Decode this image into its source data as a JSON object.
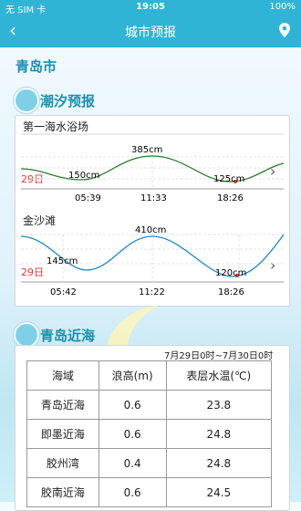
{
  "status": {
    "carrier": "无 SIM 卡",
    "time": "19:05",
    "battery": "100%"
  },
  "nav": {
    "title": "城市预报"
  },
  "city": "青岛市",
  "tide": {
    "section_title": "潮汐预报",
    "locations": [
      {
        "name": "第一海水浴场",
        "day": "29日",
        "high": "385cm",
        "low1": "150cm",
        "low2": "125cm",
        "times": [
          "05:39",
          "11:33",
          "18:26"
        ]
      },
      {
        "name": "金沙滩",
        "day": "29日",
        "high": "410cm",
        "low1": "145cm",
        "low2": "120cm",
        "times": [
          "05:42",
          "11:22",
          "18:26"
        ]
      }
    ]
  },
  "coastal": {
    "section_title": "青岛近海",
    "range": "7月29日0时~7月30日0时",
    "headers": [
      "海域",
      "浪高(m)",
      "表层水温(℃)"
    ],
    "rows": [
      [
        "青岛近海",
        "0.6",
        "23.8"
      ],
      [
        "即墨近海",
        "0.6",
        "24.8"
      ],
      [
        "胶州湾",
        "0.4",
        "24.8"
      ],
      [
        "胶南近海",
        "0.6",
        "24.5"
      ]
    ]
  }
}
